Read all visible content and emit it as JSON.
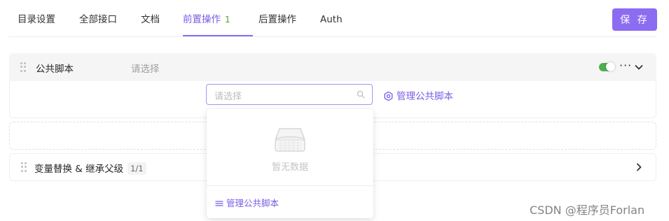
{
  "tabs": [
    {
      "label": "目录设置"
    },
    {
      "label": "全部接口"
    },
    {
      "label": "文档"
    },
    {
      "label": "前置操作",
      "badge": "1"
    },
    {
      "label": "后置操作"
    },
    {
      "label": "Auth"
    }
  ],
  "toolbar": {
    "save_label": "保 存"
  },
  "public_script_panel": {
    "title": "公共脚本",
    "select_placeholder": "请选择",
    "more_label": "···",
    "toggle_on": true,
    "toggle_color": "#4caf50"
  },
  "select": {
    "placeholder": "请选择"
  },
  "manage_link": {
    "label": "管理公共脚本"
  },
  "dropdown": {
    "empty_text": "暂无数据",
    "manage_label": "管理公共脚本"
  },
  "variable_panel": {
    "title": "变量替换 & 继承父级",
    "count": "1/1"
  },
  "watermark": "CSDN @程序员Forlan",
  "colors": {
    "accent": "#8c6cf0",
    "link": "#7b5ce6",
    "toggle": "#4caf50"
  }
}
